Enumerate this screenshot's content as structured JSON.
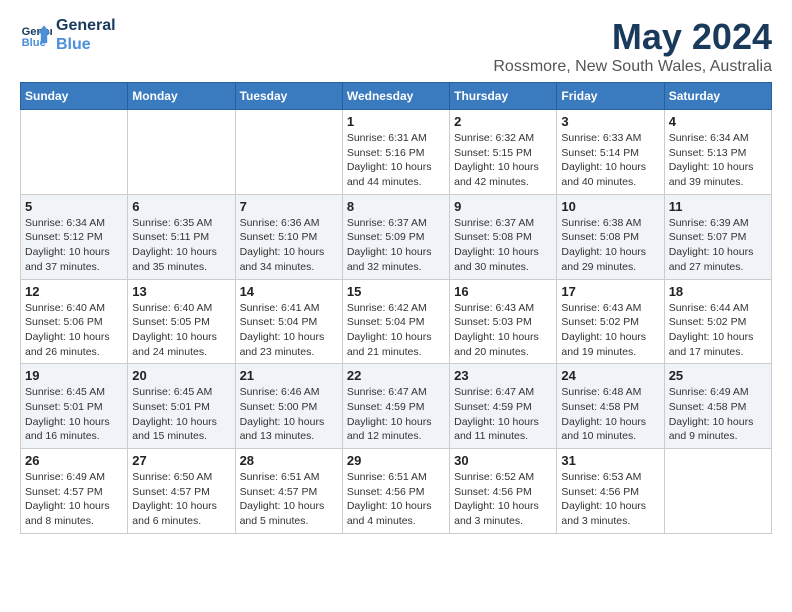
{
  "logo": {
    "line1": "General",
    "line2": "Blue"
  },
  "title": "May 2024",
  "subtitle": "Rossmore, New South Wales, Australia",
  "days_of_week": [
    "Sunday",
    "Monday",
    "Tuesday",
    "Wednesday",
    "Thursday",
    "Friday",
    "Saturday"
  ],
  "weeks": [
    [
      {
        "day": "",
        "info": ""
      },
      {
        "day": "",
        "info": ""
      },
      {
        "day": "",
        "info": ""
      },
      {
        "day": "1",
        "info": "Sunrise: 6:31 AM\nSunset: 5:16 PM\nDaylight: 10 hours\nand 44 minutes."
      },
      {
        "day": "2",
        "info": "Sunrise: 6:32 AM\nSunset: 5:15 PM\nDaylight: 10 hours\nand 42 minutes."
      },
      {
        "day": "3",
        "info": "Sunrise: 6:33 AM\nSunset: 5:14 PM\nDaylight: 10 hours\nand 40 minutes."
      },
      {
        "day": "4",
        "info": "Sunrise: 6:34 AM\nSunset: 5:13 PM\nDaylight: 10 hours\nand 39 minutes."
      }
    ],
    [
      {
        "day": "5",
        "info": "Sunrise: 6:34 AM\nSunset: 5:12 PM\nDaylight: 10 hours\nand 37 minutes."
      },
      {
        "day": "6",
        "info": "Sunrise: 6:35 AM\nSunset: 5:11 PM\nDaylight: 10 hours\nand 35 minutes."
      },
      {
        "day": "7",
        "info": "Sunrise: 6:36 AM\nSunset: 5:10 PM\nDaylight: 10 hours\nand 34 minutes."
      },
      {
        "day": "8",
        "info": "Sunrise: 6:37 AM\nSunset: 5:09 PM\nDaylight: 10 hours\nand 32 minutes."
      },
      {
        "day": "9",
        "info": "Sunrise: 6:37 AM\nSunset: 5:08 PM\nDaylight: 10 hours\nand 30 minutes."
      },
      {
        "day": "10",
        "info": "Sunrise: 6:38 AM\nSunset: 5:08 PM\nDaylight: 10 hours\nand 29 minutes."
      },
      {
        "day": "11",
        "info": "Sunrise: 6:39 AM\nSunset: 5:07 PM\nDaylight: 10 hours\nand 27 minutes."
      }
    ],
    [
      {
        "day": "12",
        "info": "Sunrise: 6:40 AM\nSunset: 5:06 PM\nDaylight: 10 hours\nand 26 minutes."
      },
      {
        "day": "13",
        "info": "Sunrise: 6:40 AM\nSunset: 5:05 PM\nDaylight: 10 hours\nand 24 minutes."
      },
      {
        "day": "14",
        "info": "Sunrise: 6:41 AM\nSunset: 5:04 PM\nDaylight: 10 hours\nand 23 minutes."
      },
      {
        "day": "15",
        "info": "Sunrise: 6:42 AM\nSunset: 5:04 PM\nDaylight: 10 hours\nand 21 minutes."
      },
      {
        "day": "16",
        "info": "Sunrise: 6:43 AM\nSunset: 5:03 PM\nDaylight: 10 hours\nand 20 minutes."
      },
      {
        "day": "17",
        "info": "Sunrise: 6:43 AM\nSunset: 5:02 PM\nDaylight: 10 hours\nand 19 minutes."
      },
      {
        "day": "18",
        "info": "Sunrise: 6:44 AM\nSunset: 5:02 PM\nDaylight: 10 hours\nand 17 minutes."
      }
    ],
    [
      {
        "day": "19",
        "info": "Sunrise: 6:45 AM\nSunset: 5:01 PM\nDaylight: 10 hours\nand 16 minutes."
      },
      {
        "day": "20",
        "info": "Sunrise: 6:45 AM\nSunset: 5:01 PM\nDaylight: 10 hours\nand 15 minutes."
      },
      {
        "day": "21",
        "info": "Sunrise: 6:46 AM\nSunset: 5:00 PM\nDaylight: 10 hours\nand 13 minutes."
      },
      {
        "day": "22",
        "info": "Sunrise: 6:47 AM\nSunset: 4:59 PM\nDaylight: 10 hours\nand 12 minutes."
      },
      {
        "day": "23",
        "info": "Sunrise: 6:47 AM\nSunset: 4:59 PM\nDaylight: 10 hours\nand 11 minutes."
      },
      {
        "day": "24",
        "info": "Sunrise: 6:48 AM\nSunset: 4:58 PM\nDaylight: 10 hours\nand 10 minutes."
      },
      {
        "day": "25",
        "info": "Sunrise: 6:49 AM\nSunset: 4:58 PM\nDaylight: 10 hours\nand 9 minutes."
      }
    ],
    [
      {
        "day": "26",
        "info": "Sunrise: 6:49 AM\nSunset: 4:57 PM\nDaylight: 10 hours\nand 8 minutes."
      },
      {
        "day": "27",
        "info": "Sunrise: 6:50 AM\nSunset: 4:57 PM\nDaylight: 10 hours\nand 6 minutes."
      },
      {
        "day": "28",
        "info": "Sunrise: 6:51 AM\nSunset: 4:57 PM\nDaylight: 10 hours\nand 5 minutes."
      },
      {
        "day": "29",
        "info": "Sunrise: 6:51 AM\nSunset: 4:56 PM\nDaylight: 10 hours\nand 4 minutes."
      },
      {
        "day": "30",
        "info": "Sunrise: 6:52 AM\nSunset: 4:56 PM\nDaylight: 10 hours\nand 3 minutes."
      },
      {
        "day": "31",
        "info": "Sunrise: 6:53 AM\nSunset: 4:56 PM\nDaylight: 10 hours\nand 3 minutes."
      },
      {
        "day": "",
        "info": ""
      }
    ]
  ]
}
